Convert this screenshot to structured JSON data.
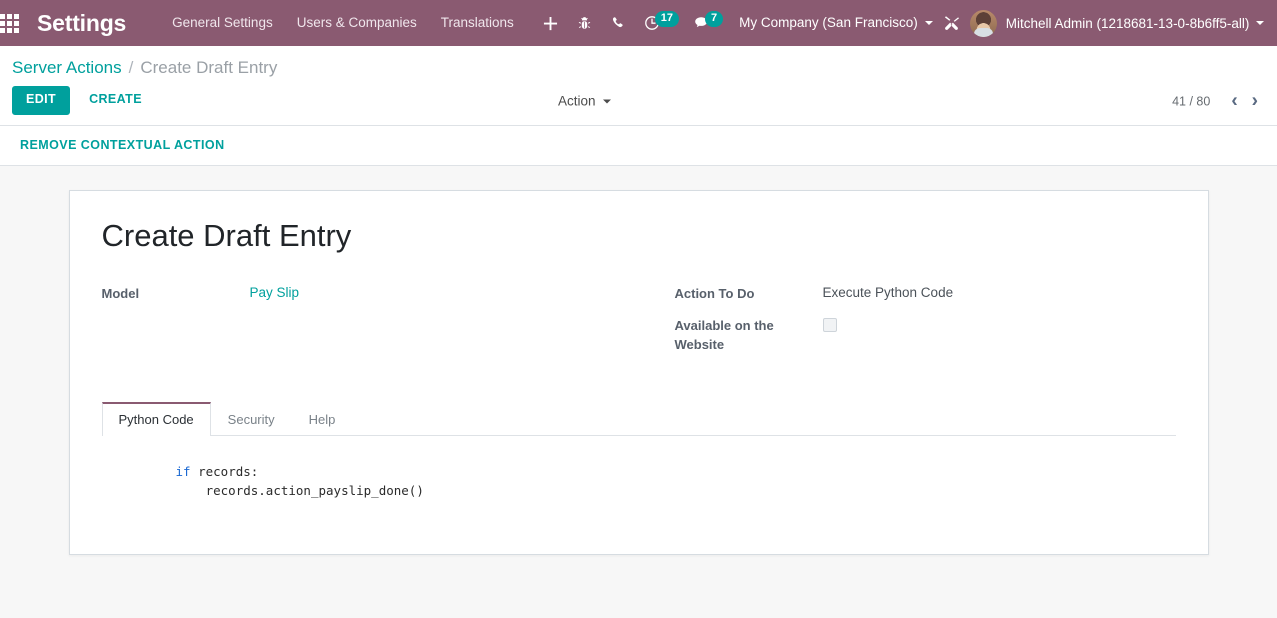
{
  "navbar": {
    "apps_icon": "apps-grid-icon",
    "brand": "Settings",
    "menu_items": [
      {
        "label": "General Settings"
      },
      {
        "label": "Users & Companies"
      },
      {
        "label": "Translations"
      }
    ],
    "icons": [
      {
        "name": "plus-icon",
        "glyph": "+"
      },
      {
        "name": "bug-icon",
        "glyph": "🐞"
      },
      {
        "name": "phone-icon",
        "glyph": "✆"
      }
    ],
    "activities": {
      "icon": "clock-icon",
      "count": "17"
    },
    "messages": {
      "icon": "chat-bubble-icon",
      "count": "7"
    },
    "company": "My Company (San Francisco)",
    "tools_icon": "wrench-screwdriver-icon",
    "user": "Mitchell Admin (1218681-13-0-8b6ff5-all)",
    "colors": {
      "navbar_bg": "#8a5a71",
      "badge_bg": "#00A09D"
    }
  },
  "control_panel": {
    "breadcrumb_root": "Server Actions",
    "breadcrumb_separator": "/",
    "breadcrumb_current": "Create Draft Entry",
    "edit_label": "EDIT",
    "create_label": "CREATE",
    "action_label": "Action",
    "pager_text": "41 / 80",
    "pager_prev": "‹",
    "pager_next": "›",
    "contextual_action_label": "REMOVE CONTEXTUAL ACTION",
    "accent_color": "#00A09D"
  },
  "form": {
    "title": "Create Draft Entry",
    "fields_left": [
      {
        "label": "Model",
        "value": "Pay Slip",
        "type": "link"
      }
    ],
    "fields_right": [
      {
        "label": "Action To Do",
        "value": "Execute Python Code",
        "type": "text"
      },
      {
        "label": "Available on the Website",
        "value": "",
        "type": "checkbox",
        "checked": false
      }
    ],
    "tabs": [
      {
        "label": "Python Code",
        "active": true
      },
      {
        "label": "Security",
        "active": false
      },
      {
        "label": "Help",
        "active": false
      }
    ],
    "python_code_keyword": "if",
    "python_code_rest": " records:\n    records.action_payslip_done()"
  }
}
